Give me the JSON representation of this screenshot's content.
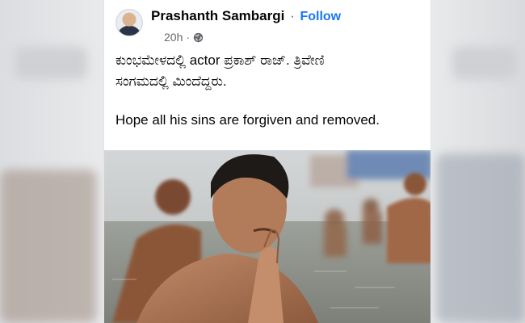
{
  "post": {
    "author": "Prashanth Sambargi",
    "separator": "·",
    "follow_label": "Follow",
    "time": "20h",
    "meta_dot": "·",
    "privacy_icon": "globe-icon",
    "text_lines": [
      "ಕುಂಭಮೇಳದಲ್ಲಿ actor  ಪ್ರಕಾಶ್ ರಾಜ್. ತ್ರಿವೇಣಿ",
      "ಸಂಗಮದಲ್ಲಿ ಮಿಂದೆದ್ದರು."
    ],
    "text_english": "Hope all his sins are forgiven and removed."
  },
  "colors": {
    "follow": "#1877f2",
    "text": "#050505",
    "meta": "#65676b"
  }
}
